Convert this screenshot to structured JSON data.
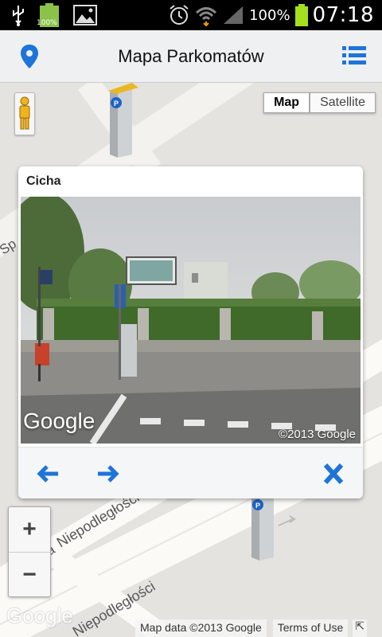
{
  "statusbar": {
    "battery_small_text": "100%",
    "battery_pct": "100%",
    "time": "07:18"
  },
  "actionbar": {
    "title": "Mapa Parkomatów",
    "location_icon": "location-pin-icon",
    "list_icon": "list-icon",
    "accent": "#1e74d8"
  },
  "map": {
    "maptype": {
      "map_label": "Map",
      "satellite_label": "Satellite"
    },
    "streets": [
      "Sp",
      "Niepodległości",
      "Niepodległości"
    ],
    "street_partial": "a",
    "zoom_in": "+",
    "zoom_out": "−",
    "google_logo": "Google",
    "attribution": {
      "data": "Map data ©2013 Google",
      "terms": "Terms of Use",
      "corner": "⇱"
    }
  },
  "info_window": {
    "title": "Cicha",
    "streetview": {
      "logo": "Google",
      "copyright": "©2013 Google"
    },
    "prev_icon": "arrow-left-icon",
    "next_icon": "arrow-right-icon",
    "close_icon": "close-icon"
  }
}
